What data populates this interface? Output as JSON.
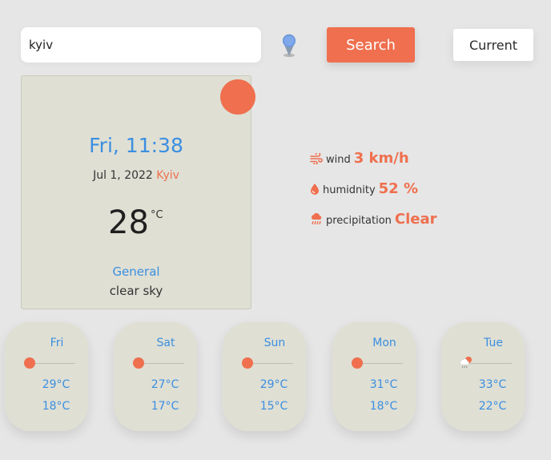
{
  "search": {
    "value": "kyiv",
    "button_label": "Search"
  },
  "current_button_label": "Current",
  "current": {
    "day_time": "Fri, 11:38",
    "date": "Jul 1, 2022",
    "city": "Kyiv",
    "temperature": "28",
    "unit": "°C",
    "general_label": "General",
    "description": "clear sky"
  },
  "stats": {
    "wind_label": "wind",
    "wind_value": "3 km/h",
    "humidity_label": "humidnity",
    "humidity_value": "52 %",
    "precipitation_label": "precipitation",
    "precipitation_value": "Clear"
  },
  "forecast": [
    {
      "day": "Fri",
      "max": "29°C",
      "min": "18°C",
      "icon": "sun-icon"
    },
    {
      "day": "Sat",
      "max": "27°C",
      "min": "17°C",
      "icon": "sun-icon"
    },
    {
      "day": "Sun",
      "max": "29°C",
      "min": "15°C",
      "icon": "sun-icon"
    },
    {
      "day": "Mon",
      "max": "31°C",
      "min": "18°C",
      "icon": "sun-icon"
    },
    {
      "day": "Tue",
      "max": "33°C",
      "min": "22°C",
      "icon": "cloud-rain-icon"
    }
  ],
  "colors": {
    "accent": "#ef6f4e",
    "blue": "#3b8fe0",
    "card": "#dfdfd4",
    "background": "#e6e6e6"
  }
}
